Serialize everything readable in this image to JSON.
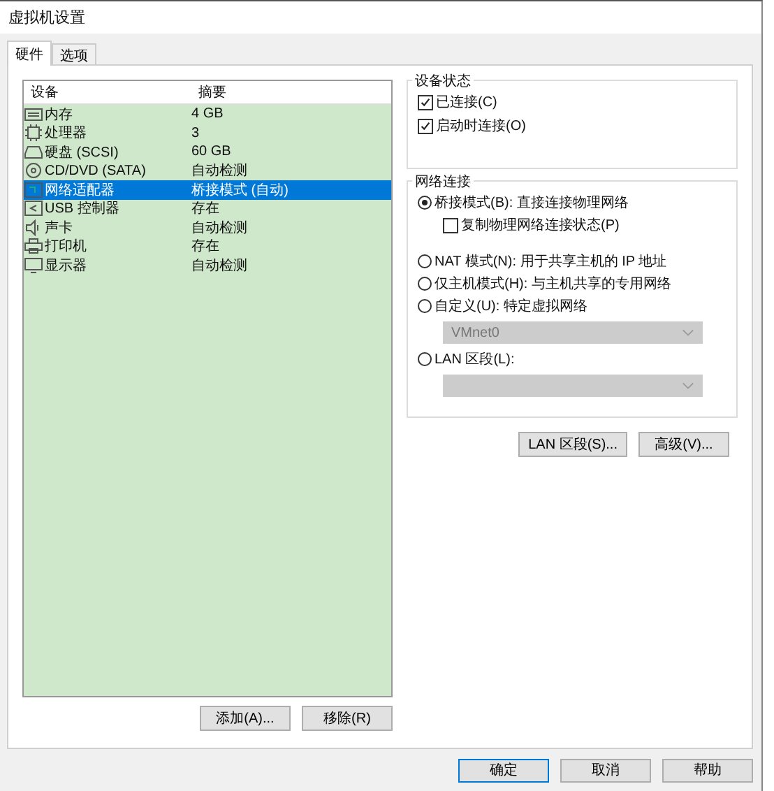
{
  "window": {
    "title": "虚拟机设置"
  },
  "tabs": [
    {
      "label": "硬件",
      "selected": true
    },
    {
      "label": "选项",
      "selected": false
    }
  ],
  "device_table": {
    "columns": [
      "设备",
      "摘要"
    ],
    "rows": [
      {
        "device": "内存",
        "summary": "4 GB",
        "selected": false
      },
      {
        "device": "处理器",
        "summary": "3",
        "selected": false
      },
      {
        "device": "硬盘 (SCSI)",
        "summary": "60 GB",
        "selected": false
      },
      {
        "device": "CD/DVD (SATA)",
        "summary": "自动检测",
        "selected": false
      },
      {
        "device": "网络适配器",
        "summary": "桥接模式 (自动)",
        "selected": true
      },
      {
        "device": "USB 控制器",
        "summary": "存在",
        "selected": false
      },
      {
        "device": "声卡",
        "summary": "自动检测",
        "selected": false
      },
      {
        "device": "打印机",
        "summary": "存在",
        "selected": false
      },
      {
        "device": "显示器",
        "summary": "自动检测",
        "selected": false
      }
    ]
  },
  "list_buttons": [
    "添加(A)...",
    "移除(R)"
  ],
  "device_status": {
    "title": "设备状态",
    "checkboxes": [
      {
        "label": "已连接(C)",
        "checked": true
      },
      {
        "label": "启动时连接(O)",
        "checked": true
      }
    ]
  },
  "network_connection": {
    "title": "网络连接",
    "items": [
      {
        "kind": "radio",
        "label": "桥接模式(B): 直接连接物理网络",
        "selected": true
      },
      {
        "kind": "checkbox",
        "label": "复制物理网络连接状态(P)",
        "checked": false
      },
      {
        "kind": "radio",
        "label": "NAT 模式(N): 用于共享主机的 IP 地址",
        "selected": false
      },
      {
        "kind": "radio",
        "label": "仅主机模式(H): 与主机共享的专用网络",
        "selected": false
      },
      {
        "kind": "radio",
        "label": "自定义(U): 特定虚拟网络",
        "selected": false
      },
      {
        "kind": "select",
        "value": "VMnet0",
        "disabled": true
      },
      {
        "kind": "radio",
        "label": "LAN 区段(L):",
        "selected": false
      },
      {
        "kind": "select",
        "disabled": true
      }
    ]
  },
  "network_buttons": [
    "LAN 区段(S)...",
    "高级(V)..."
  ],
  "dialog_buttons": [
    {
      "label": "确定",
      "default": true
    },
    {
      "label": "取消",
      "default": false
    },
    {
      "label": "帮助",
      "default": false
    }
  ]
}
